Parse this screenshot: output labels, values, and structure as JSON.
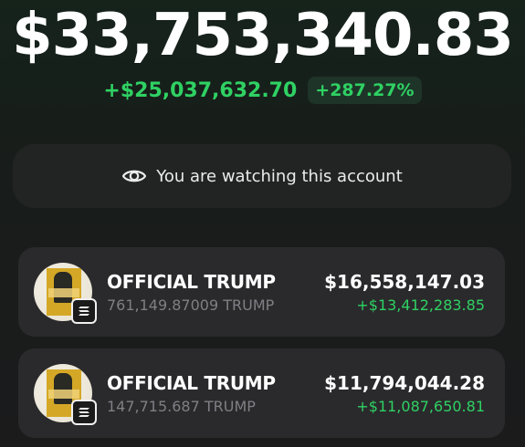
{
  "portfolio": {
    "balance": "$33,753,340.83",
    "change_amount": "+$25,037,632.70",
    "change_percent": "+287.27%"
  },
  "watch_banner": {
    "icon": "eye-icon",
    "text": "You are watching this account"
  },
  "tokens": [
    {
      "name": "OFFICIAL TRUMP",
      "quantity": "761,149.87009 TRUMP",
      "value": "$16,558,147.03",
      "gain": "+$13,412,283.85",
      "icon": "trump-token-icon",
      "chain_icon": "solana-icon"
    },
    {
      "name": "OFFICIAL TRUMP",
      "quantity": "147,715.687 TRUMP",
      "value": "$11,794,044.28",
      "gain": "+$11,087,650.81",
      "icon": "trump-token-icon",
      "chain_icon": "solana-icon"
    }
  ],
  "colors": {
    "positive": "#2fd163",
    "card": "#2a2a2c",
    "banner": "#222423"
  }
}
